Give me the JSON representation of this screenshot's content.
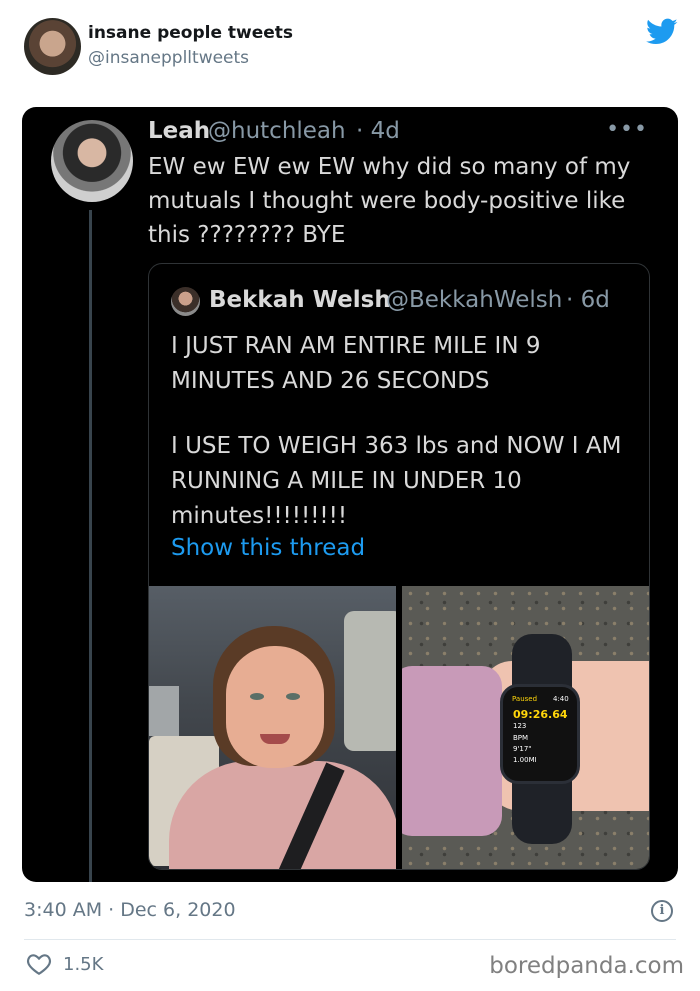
{
  "account": {
    "display_name": "insane people tweets",
    "handle": "@insanepplltweets"
  },
  "quoting_tweet": {
    "name": "Leah",
    "handle": "@hutchleah",
    "time": "· 4d",
    "text": "EW ew EW ew EW why did so many of my mutuals I thought were body-positive like this ???????? BYE"
  },
  "quoted_tweet": {
    "name": "Bekkah Welsh",
    "handle": "@BekkahWelsh",
    "time": "· 6d",
    "paragraph1": "I JUST RAN AM ENTIRE MILE IN 9 MINUTES AND 26 SECONDS",
    "paragraph2": "I USE TO WEIGH 363 lbs and NOW I AM RUNNING A MILE IN UNDER 10 minutes!!!!!!!!!",
    "show_thread": "Show this thread"
  },
  "watch": {
    "status": "Paused",
    "clock": "4:40",
    "timer": "09:26.64",
    "line1": "123",
    "line2": "BPM",
    "line3": "9'17\"",
    "line4": "1.00MI"
  },
  "footer": {
    "timestamp": "3:40 AM · Dec 6, 2020",
    "likes": "1.5K",
    "watermark": "boredpanda.com"
  },
  "colors": {
    "twitter_blue": "#1d9bf0",
    "link": "#1d9bf0",
    "dark_bg": "#000000"
  },
  "icons": [
    "twitter-bird-icon",
    "more-icon",
    "info-icon",
    "heart-icon"
  ]
}
